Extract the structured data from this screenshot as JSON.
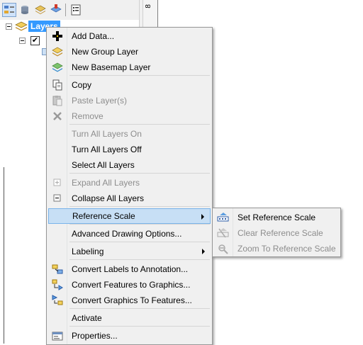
{
  "toc": {
    "root_layer_label": "Layers",
    "root_checked_mark": "✔"
  },
  "menu": {
    "items": [
      {
        "label": "Add Data...",
        "icon": "add-data-icon",
        "enabled": true
      },
      {
        "label": "New Group Layer",
        "icon": "group-layer-icon",
        "enabled": true
      },
      {
        "label": "New Basemap Layer",
        "icon": "basemap-layer-icon",
        "enabled": true
      },
      {
        "label": "Copy",
        "icon": "copy-icon",
        "enabled": true
      },
      {
        "label": "Paste Layer(s)",
        "icon": "paste-icon",
        "enabled": false
      },
      {
        "label": "Remove",
        "icon": "remove-icon",
        "enabled": false
      },
      {
        "label": "Turn All Layers On",
        "icon": "",
        "enabled": false
      },
      {
        "label": "Turn All Layers Off",
        "icon": "",
        "enabled": true
      },
      {
        "label": "Select All Layers",
        "icon": "",
        "enabled": true
      },
      {
        "label": "Expand All Layers",
        "icon": "expand-icon",
        "enabled": false
      },
      {
        "label": "Collapse All Layers",
        "icon": "collapse-icon",
        "enabled": true
      },
      {
        "label": "Reference Scale",
        "icon": "",
        "enabled": true,
        "submenu": true,
        "highlighted": true
      },
      {
        "label": "Advanced Drawing Options...",
        "icon": "",
        "enabled": true
      },
      {
        "label": "Labeling",
        "icon": "",
        "enabled": true,
        "submenu": true
      },
      {
        "label": "Convert Labels to Annotation...",
        "icon": "labels-to-annotation-icon",
        "enabled": true
      },
      {
        "label": "Convert Features to Graphics...",
        "icon": "features-to-graphics-icon",
        "enabled": true
      },
      {
        "label": "Convert Graphics To Features...",
        "icon": "graphics-to-features-icon",
        "enabled": true
      },
      {
        "label": "Activate",
        "icon": "",
        "enabled": true
      },
      {
        "label": "Properties...",
        "icon": "properties-icon",
        "enabled": true
      }
    ]
  },
  "submenu": {
    "items": [
      {
        "label": "Set Reference Scale",
        "icon": "set-reference-scale-icon",
        "enabled": true
      },
      {
        "label": "Clear Reference Scale",
        "icon": "clear-reference-scale-icon",
        "enabled": false
      },
      {
        "label": "Zoom To Reference Scale",
        "icon": "zoom-reference-scale-icon",
        "enabled": false
      }
    ]
  },
  "ruler": {
    "text": "8"
  },
  "colors": {
    "selection": "#3399ff",
    "menu_hover": "#c7dff5",
    "menu_bg": "#f0f0f0",
    "disabled_text": "#8d8d8d"
  }
}
